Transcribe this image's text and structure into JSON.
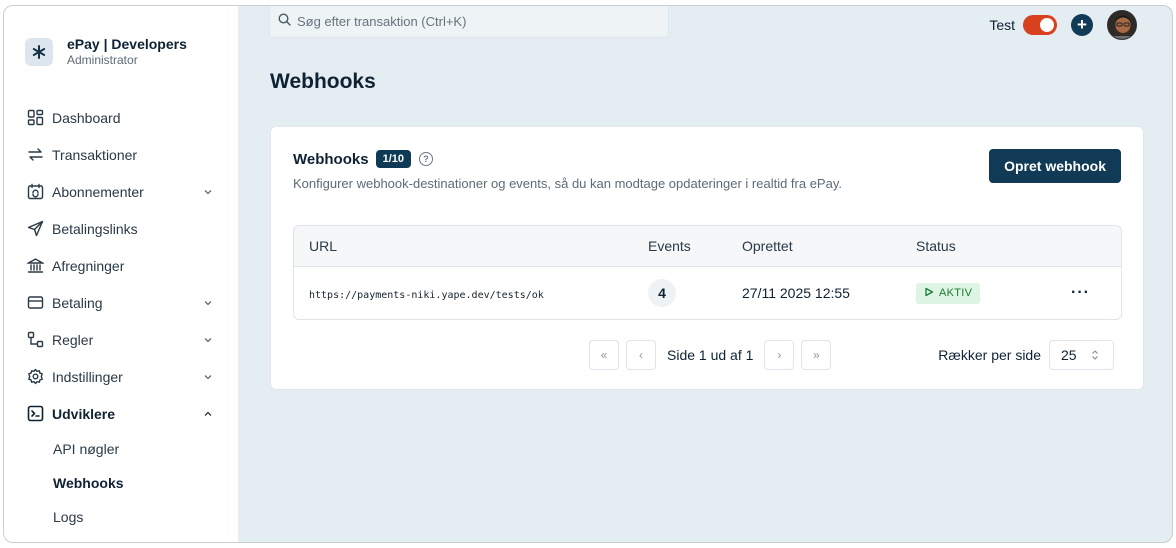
{
  "brand": {
    "name": "ePay | Developers",
    "role": "Administrator"
  },
  "nav": {
    "items": [
      {
        "label": "Dashboard",
        "has_chevron": false
      },
      {
        "label": "Transaktioner",
        "has_chevron": false
      },
      {
        "label": "Abonnementer",
        "has_chevron": true
      },
      {
        "label": "Betalingslinks",
        "has_chevron": false
      },
      {
        "label": "Afregninger",
        "has_chevron": false
      },
      {
        "label": "Betaling",
        "has_chevron": true
      },
      {
        "label": "Regler",
        "has_chevron": true
      },
      {
        "label": "Indstillinger",
        "has_chevron": true
      },
      {
        "label": "Udviklere",
        "has_chevron": true,
        "expanded": true
      }
    ],
    "sub_items": [
      {
        "label": "API nøgler"
      },
      {
        "label": "Webhooks",
        "active": true
      },
      {
        "label": "Logs"
      }
    ]
  },
  "search": {
    "placeholder": "Søg efter transaktion (Ctrl+K)"
  },
  "topbar": {
    "test_label": "Test",
    "test_mode_on": true,
    "plus_symbol": "+"
  },
  "page": {
    "title": "Webhooks"
  },
  "card": {
    "title": "Webhooks",
    "count_badge": "1/10",
    "help_symbol": "?",
    "description": "Konfigurer webhook-destinationer og events, så du kan modtage opdateringer i realtid fra ePay.",
    "create_button": "Opret webhook"
  },
  "table": {
    "headers": {
      "url": "URL",
      "events": "Events",
      "created": "Oprettet",
      "status": "Status"
    },
    "rows": [
      {
        "url": "https://payments-niki.yape.dev/tests/ok",
        "events": "4",
        "created": "27/11 2025 12:55",
        "status": "AKTIV",
        "more": "···"
      }
    ]
  },
  "pagination": {
    "page_text": "Side 1 ud af 1",
    "rows_per_page_label": "Rækker per side",
    "rows_per_page_value": "25",
    "first_symbol": "«",
    "prev_symbol": "‹",
    "next_symbol": "›",
    "last_symbol": "»"
  },
  "colors": {
    "brand_dark": "#103a55",
    "toggle_on": "#d9401e",
    "status_green_bg": "#def5e3",
    "status_green_text": "#1b7b34",
    "content_bg": "#e3edf2"
  }
}
